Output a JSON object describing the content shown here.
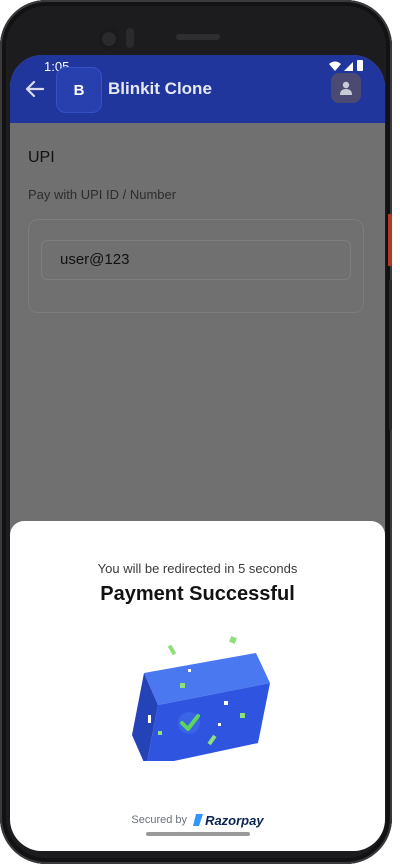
{
  "status_bar": {
    "time": "1:05"
  },
  "header": {
    "logo_letter": "B",
    "title": "Blinkit Clone",
    "icons": {
      "back": "back-arrow-icon",
      "profile": "user-icon"
    }
  },
  "upi": {
    "title": "UPI",
    "subtitle": "Pay with UPI ID / Number",
    "input_value": "user@123"
  },
  "sheet": {
    "redirect_text": "You will be redirected in 5 seconds",
    "title": "Payment Successful",
    "secured_by": "Secured by",
    "brand": "Razorpay",
    "illustration": "success-box-checkmark-icon"
  },
  "colors": {
    "header_bg": "#20369c",
    "overlay": "#707070",
    "sheet_bg": "#ffffff",
    "box_blue": "#2f55e0",
    "check_green": "#5cd65c"
  }
}
